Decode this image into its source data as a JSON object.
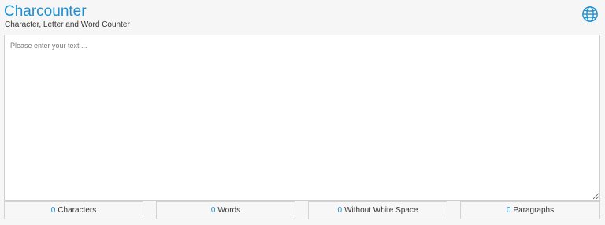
{
  "header": {
    "title": "Charcounter",
    "subtitle": "Character, Letter and Word Counter",
    "language_icon": "globe-icon"
  },
  "editor": {
    "placeholder": "Please enter your text ...",
    "value": ""
  },
  "stats": [
    {
      "count": "0",
      "label": "Characters"
    },
    {
      "count": "0",
      "label": "Words"
    },
    {
      "count": "0",
      "label": "Without White Space"
    },
    {
      "count": "0",
      "label": "Paragraphs"
    }
  ],
  "colors": {
    "accent": "#1d8fd0",
    "background": "#f6f6f6"
  }
}
